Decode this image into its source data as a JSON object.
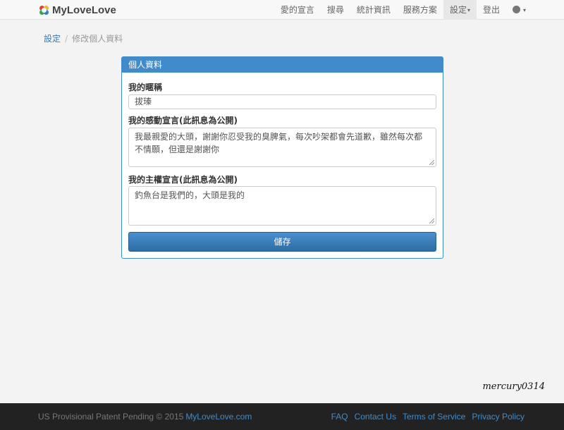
{
  "brand": {
    "name": "MyLoveLove"
  },
  "nav": {
    "items": [
      "愛的宣言",
      "搜尋",
      "統計資訊",
      "服務方案"
    ],
    "settings": "設定",
    "logout": "登出",
    "language_icon": "globe-icon"
  },
  "breadcrumb": {
    "parent": "設定",
    "current": "修改個人資料"
  },
  "panel": {
    "heading": "個人資料",
    "nickname_label": "我的暱稱",
    "nickname_value": "拔瑧",
    "thanks_label": "我的感動宣言(此訊息為公開)",
    "thanks_value": "我最親愛的大頭，謝謝你忍受我的臭脾氣，每次吵架都會先道歉，雖然每次都不情願，但還是謝謝你",
    "main_label": "我的主權宣言(此訊息為公開)",
    "main_value": "釣魚台是我們的，大頭是我的",
    "save_label": "儲存"
  },
  "watermark": "mercury0314",
  "footer": {
    "copyright": "US Provisional Patent Pending © 2015",
    "site": "MyLoveLove.com",
    "links": [
      "FAQ",
      "Contact Us",
      "Terms of Service",
      "Privacy Policy"
    ]
  },
  "colors": {
    "primary": "#428bca",
    "footer_bg": "#222222",
    "page_bg": "#f3f3f3"
  }
}
